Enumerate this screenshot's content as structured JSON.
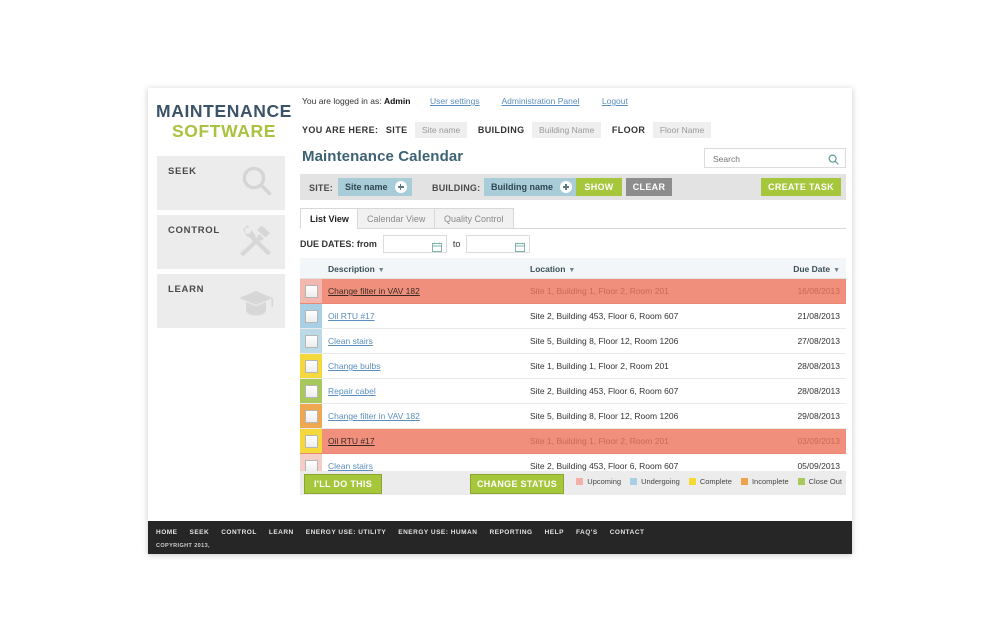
{
  "brand": {
    "line1": "MAINTENANCE",
    "line2": "SOFTWARE",
    "color1": "#3b5368",
    "color2": "#a9c23f"
  },
  "sidebar": {
    "items": [
      {
        "label": "SEEK",
        "icon": "magnifier-icon"
      },
      {
        "label": "CONTROL",
        "icon": "hammer-wrench-icon"
      },
      {
        "label": "LEARN",
        "icon": "graduation-cap-icon"
      }
    ]
  },
  "userbar": {
    "prefix": "You are logged in as:",
    "user": "Admin",
    "links": [
      "User settings",
      "Administration Panel",
      "Logout"
    ]
  },
  "breadcrumb": {
    "prefix": "YOU ARE HERE:",
    "pairs": [
      {
        "key": "SITE",
        "value": "Site name"
      },
      {
        "key": "BUILDING",
        "value": "Building Name"
      },
      {
        "key": "FLOOR",
        "value": "Floor Name"
      }
    ]
  },
  "header": {
    "title": "Maintenance Calendar"
  },
  "search": {
    "placeholder": "Search",
    "value": "",
    "icon": "search-icon"
  },
  "filterbar": {
    "site_label": "SITE:",
    "site_value": "Site name",
    "building_label": "BUILDING:",
    "building_value": "Building name",
    "show_label": "SHOW",
    "clear_label": "CLEAR",
    "create_label": "CREATE TASK",
    "pill_color": "#a9cdd8",
    "green": "#a6c63c",
    "grey": "#8d8d8d"
  },
  "tabs": [
    {
      "label": "List View",
      "active": true
    },
    {
      "label": "Calendar View",
      "active": false
    },
    {
      "label": "Quality Control",
      "active": false
    }
  ],
  "duedates": {
    "label": "DUE DATES: from",
    "to_label": "to",
    "from_value": "",
    "to_value": "",
    "icon": "calendar-icon"
  },
  "table": {
    "columns": [
      "Description",
      "Location",
      "Due Date"
    ],
    "rows": [
      {
        "status": "#f2b8b0",
        "description": "Change filter in VAV 182",
        "location": "Site 1, Building 1, Floor 2, Room 201",
        "due": "16/08/2013",
        "selected": true
      },
      {
        "status": "#a8cfe4",
        "description": "Oil RTU #17",
        "location": "Site 2, Building 453, Floor 6, Room 607",
        "due": "21/08/2013",
        "selected": false
      },
      {
        "status": "#bcd9e8",
        "description": "Clean stairs",
        "location": "Site 5, Building 8, Floor 12, Room 1206",
        "due": "27/08/2013",
        "selected": false
      },
      {
        "status": "#f5d93c",
        "description": "Change bulbs",
        "location": "Site 1, Building 1, Floor 2, Room 201",
        "due": "28/08/2013",
        "selected": false
      },
      {
        "status": "#a8c85c",
        "description": "Repair cabel",
        "location": "Site 2, Building 453, Floor 6, Room 607",
        "due": "28/08/2013",
        "selected": false
      },
      {
        "status": "#f0a850",
        "description": "Change filter in VAV 182",
        "location": "Site 5, Building 8, Floor 12, Room 1206",
        "due": "29/08/2013",
        "selected": false
      },
      {
        "status": "#f5d93c",
        "description": "Oil RTU #17",
        "location": "Site 1, Building 1, Floor 2, Room 201",
        "due": "03/09/2013",
        "selected": true
      },
      {
        "status": "#f4cdc6",
        "description": "Clean stairs",
        "location": "Site 2, Building 453, Floor 6, Room 607",
        "due": "05/09/2013",
        "selected": false
      }
    ]
  },
  "actions": {
    "ill_do_this": "I'LL DO THIS",
    "change_status": "CHANGE STATUS",
    "legend": [
      {
        "label": "Upcoming",
        "color": "#f2b0a6"
      },
      {
        "label": "Undergoing",
        "color": "#a8cfe4"
      },
      {
        "label": "Complete",
        "color": "#f7d936"
      },
      {
        "label": "Incomplete",
        "color": "#f0a24a"
      },
      {
        "label": "Close Out",
        "color": "#a8c85c"
      }
    ]
  },
  "footer": {
    "nav": [
      "HOME",
      "SEEK",
      "CONTROL",
      "LEARN",
      "ENERGY USE: UTILITY",
      "ENERGY USE: HUMAN",
      "REPORTING",
      "HELP",
      "FAQ'S",
      "CONTACT"
    ],
    "copyright": "COPYRIGHT 2013,"
  }
}
